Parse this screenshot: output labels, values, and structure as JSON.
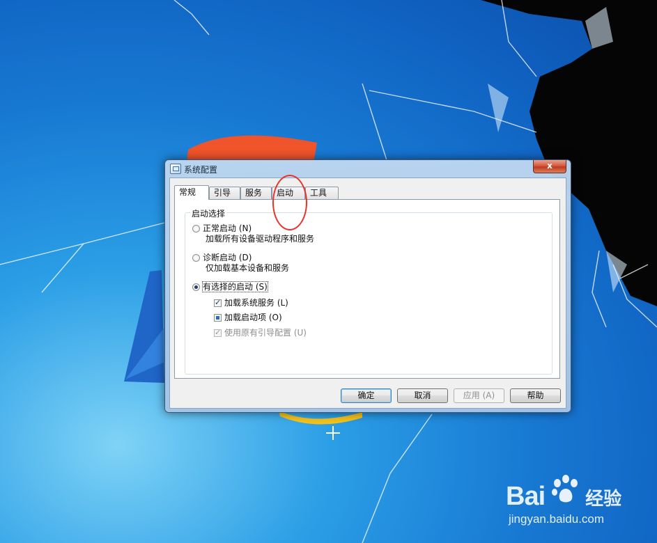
{
  "window": {
    "title": "系统配置",
    "close_label": "x"
  },
  "tabs": [
    {
      "label": "常规",
      "active": true
    },
    {
      "label": "引导",
      "active": false
    },
    {
      "label": "服务",
      "active": false
    },
    {
      "label": "启动",
      "active": false
    },
    {
      "label": "工具",
      "active": false
    }
  ],
  "startup_group": {
    "legend": "启动选择",
    "normal": {
      "label": "正常启动 (N)",
      "desc": "加载所有设备驱动程序和服务",
      "selected": false
    },
    "diagnostic": {
      "label": "诊断启动 (D)",
      "desc": "仅加载基本设备和服务",
      "selected": false
    },
    "selective": {
      "label": "有选择的启动 (S)",
      "selected": true
    },
    "load_system_services": {
      "label": "加载系统服务 (L)",
      "state": "checked"
    },
    "load_startup_items": {
      "label": "加载启动项 (O)",
      "state": "indeterminate"
    },
    "use_original_boot": {
      "label": "使用原有引导配置 (U)",
      "state": "checked-disabled"
    }
  },
  "buttons": {
    "ok": "确定",
    "cancel": "取消",
    "apply": "应用 (A)",
    "help": "帮助"
  },
  "watermark": {
    "brand": "Bai",
    "brand_suffix": "经验",
    "url": "jingyan.baidu.com"
  },
  "colors": {
    "annotation": "#e8322a",
    "desktop_blue": "#1778d2"
  }
}
